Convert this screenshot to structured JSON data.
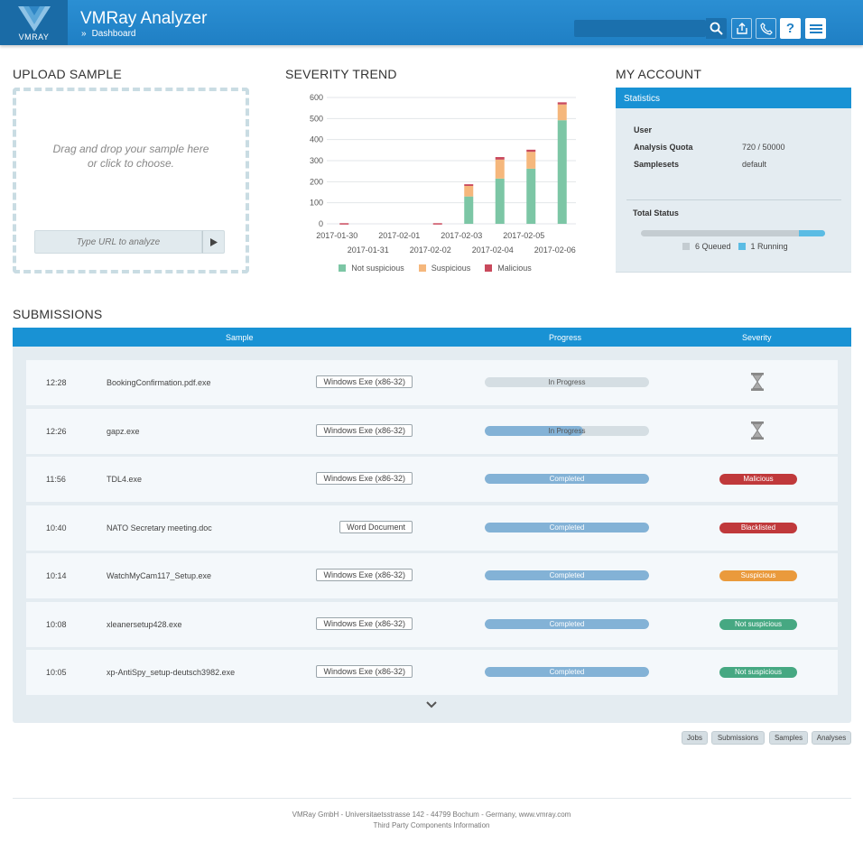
{
  "header": {
    "logo_text": "VMRAY",
    "title": "VMRay Analyzer",
    "breadcrumb_sep": "»",
    "breadcrumb": "Dashboard",
    "search_placeholder": "",
    "icons": [
      "search-icon",
      "upload-icon",
      "phone-icon",
      "help-icon",
      "menu-icon"
    ],
    "help_glyph": "?"
  },
  "upload": {
    "title": "UPLOAD SAMPLE",
    "drop_line1": "Drag and drop your sample here",
    "drop_line2": "or click to choose.",
    "url_placeholder": "Type URL to analyze"
  },
  "trend": {
    "title": "SEVERITY TREND"
  },
  "chart_data": {
    "type": "bar",
    "stacked": true,
    "categories": [
      "2017-01-30",
      "2017-01-31",
      "2017-02-01",
      "2017-02-02",
      "2017-02-03",
      "2017-02-04",
      "2017-02-05",
      "2017-02-06"
    ],
    "series": [
      {
        "name": "Not suspicious",
        "color": "#7cc6a5",
        "values": [
          0,
          0,
          0,
          0,
          130,
          215,
          262,
          492
        ]
      },
      {
        "name": "Suspicious",
        "color": "#f5b77c",
        "values": [
          0,
          0,
          0,
          0,
          50,
          90,
          80,
          75
        ]
      },
      {
        "name": "Malicious",
        "color": "#c9495c",
        "values": [
          3,
          0,
          0,
          3,
          8,
          12,
          10,
          10
        ]
      }
    ],
    "yticks": [
      0,
      100,
      200,
      300,
      400,
      500,
      600
    ],
    "ylim": [
      0,
      600
    ],
    "grid": true,
    "legend": "bottom"
  },
  "account": {
    "title": "MY ACCOUNT",
    "panel_title": "Statistics",
    "stats": [
      {
        "key": "User",
        "value": ""
      },
      {
        "key": "Analysis Quota",
        "value": "720 / 50000"
      },
      {
        "key": "Samplesets",
        "value": "default"
      }
    ],
    "total_status_label": "Total Status",
    "queued_label": "6 Queued",
    "running_label": "1 Running",
    "queued": 6,
    "running": 1,
    "queued_color": "#c4ccd1",
    "running_color": "#5bbce4"
  },
  "submissions": {
    "title": "SUBMISSIONS",
    "columns": {
      "sample": "Sample",
      "progress": "Progress",
      "severity": "Severity"
    },
    "rows": [
      {
        "time": "12:28",
        "file": "BookingConfirmation.pdf.exe",
        "type": "Windows Exe (x86-32)",
        "progress_label": "In Progress",
        "progress": 0,
        "severity": "",
        "pending": true
      },
      {
        "time": "12:26",
        "file": "gapz.exe",
        "type": "Windows Exe (x86-32)",
        "progress_label": "In Progress",
        "progress": 60,
        "severity": "",
        "pending": true
      },
      {
        "time": "11:56",
        "file": "TDL4.exe",
        "type": "Windows Exe (x86-32)",
        "progress_label": "Completed",
        "progress": 100,
        "severity": "Malicious",
        "severity_color": "#c0393b"
      },
      {
        "time": "10:40",
        "file": "NATO Secretary meeting.doc",
        "type": "Word Document",
        "progress_label": "Completed",
        "progress": 100,
        "severity": "Blacklisted",
        "severity_color": "#c0393b"
      },
      {
        "time": "10:14",
        "file": "WatchMyCam117_Setup.exe",
        "type": "Windows Exe (x86-32)",
        "progress_label": "Completed",
        "progress": 100,
        "severity": "Suspicious",
        "severity_color": "#ea9a3c"
      },
      {
        "time": "10:08",
        "file": "xleanersetup428.exe",
        "type": "Windows Exe (x86-32)",
        "progress_label": "Completed",
        "progress": 100,
        "severity": "Not suspicious",
        "severity_color": "#46a882"
      },
      {
        "time": "10:05",
        "file": "xp-AntiSpy_setup-deutsch3982.exe",
        "type": "Windows Exe (x86-32)",
        "progress_label": "Completed",
        "progress": 100,
        "severity": "Not suspicious",
        "severity_color": "#46a882"
      }
    ],
    "buttons": [
      "Jobs",
      "Submissions",
      "Samples",
      "Analyses"
    ]
  },
  "footer": {
    "line1": "VMRay GmbH - Universitaetsstrasse 142 - 44799 Bochum - Germany, www.vmray.com",
    "line2": "Third Party Components Information"
  }
}
